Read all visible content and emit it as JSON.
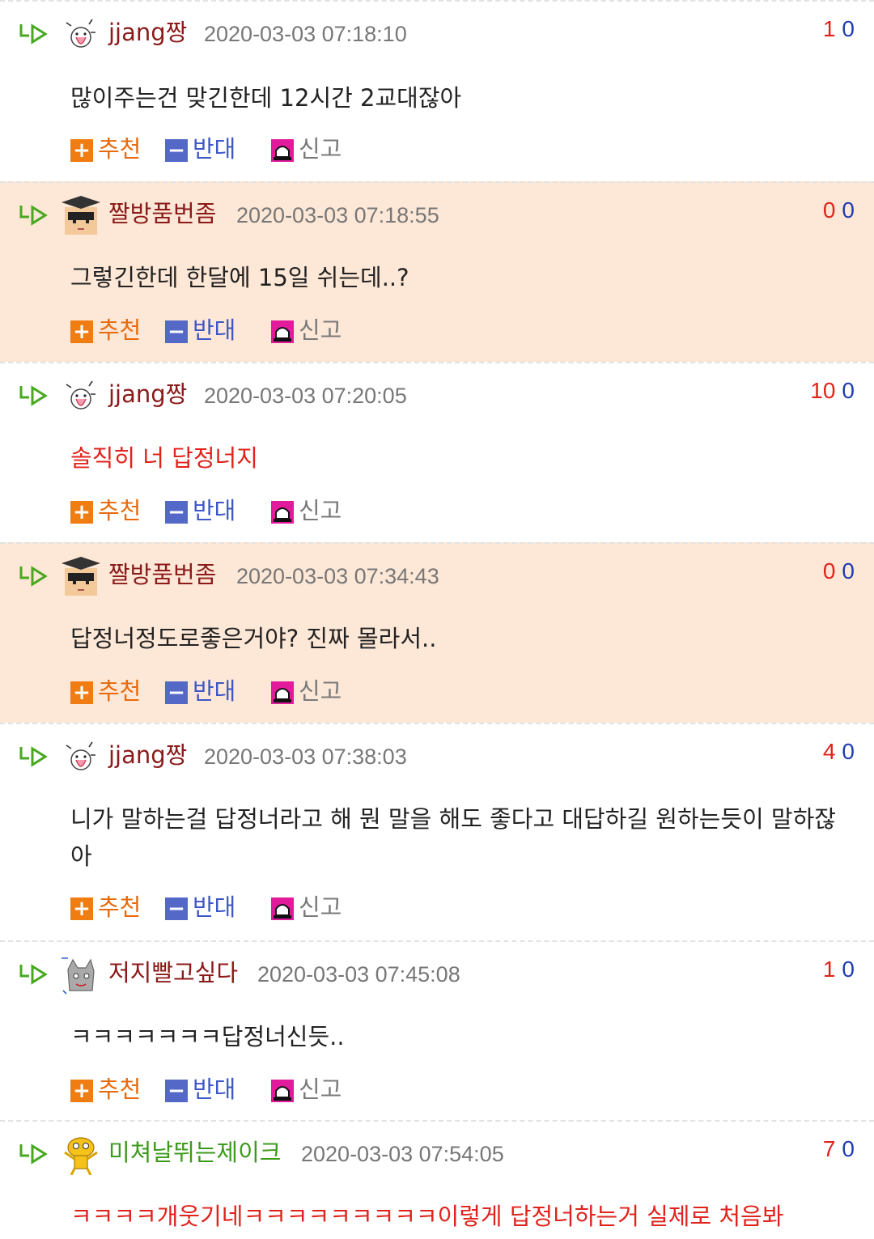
{
  "labels": {
    "recommend": "추천",
    "oppose": "반대",
    "report": "신고"
  },
  "colors": {
    "highlight_bg": "#fde7d6",
    "recommend": "#f07d12",
    "oppose": "#5468c8",
    "report": "#e21a9c",
    "vote_up": "#e0231c",
    "vote_down": "#1f3db0",
    "nick_default": "#8b1a1a",
    "nick_green": "#3d9a1c"
  },
  "comments": [
    {
      "nick": "jjang짱",
      "avatar": "dog-tongue-avatar",
      "time": "2020-03-03 07:18:10",
      "up": "1",
      "down": "0",
      "text": "많이주는건 맞긴한데 12시간 2교대잖아",
      "highlight": false,
      "text_red": false,
      "nick_color": "#8b1a1a"
    },
    {
      "nick": "짤방품번좀",
      "avatar": "graduate-cap-avatar",
      "time": "2020-03-03 07:18:55",
      "up": "0",
      "down": "0",
      "text": "그렇긴한데 한달에 15일 쉬는데..?",
      "highlight": true,
      "text_red": false,
      "nick_color": "#8b1a1a"
    },
    {
      "nick": "jjang짱",
      "avatar": "dog-tongue-avatar",
      "time": "2020-03-03 07:20:05",
      "up": "10",
      "down": "0",
      "text": "솔직히 너 답정너지",
      "highlight": false,
      "text_red": true,
      "nick_color": "#8b1a1a"
    },
    {
      "nick": "짤방품번좀",
      "avatar": "graduate-cap-avatar",
      "time": "2020-03-03 07:34:43",
      "up": "0",
      "down": "0",
      "text": "답정너정도로좋은거야? 진짜 몰라서..",
      "highlight": true,
      "text_red": false,
      "nick_color": "#8b1a1a"
    },
    {
      "nick": "jjang짱",
      "avatar": "dog-tongue-avatar",
      "time": "2020-03-03 07:38:03",
      "up": "4",
      "down": "0",
      "text": "니가 말하는걸 답정너라고 해 뭔 말을 해도 좋다고 대답하길 원하는듯이 말하잖아",
      "highlight": false,
      "text_red": false,
      "nick_color": "#8b1a1a"
    },
    {
      "nick": "저지빨고싶다",
      "avatar": "derp-cat-avatar",
      "time": "2020-03-03 07:45:08",
      "up": "1",
      "down": "0",
      "text": "ㅋㅋㅋㅋㅋㅋㅋ답정너신듯..",
      "highlight": false,
      "text_red": false,
      "nick_color": "#8b1a1a"
    },
    {
      "nick": "미쳐날뛰는제이크",
      "avatar": "jake-dog-avatar",
      "time": "2020-03-03 07:54:05",
      "up": "7",
      "down": "0",
      "text": "ㅋㅋㅋㅋ개웃기네ㅋㅋㅋㅋㅋㅋㅋㅋㅋ이렇게 답정너하는거 실제로 처음봐",
      "highlight": false,
      "text_red": true,
      "nick_color": "#3d9a1c"
    }
  ]
}
